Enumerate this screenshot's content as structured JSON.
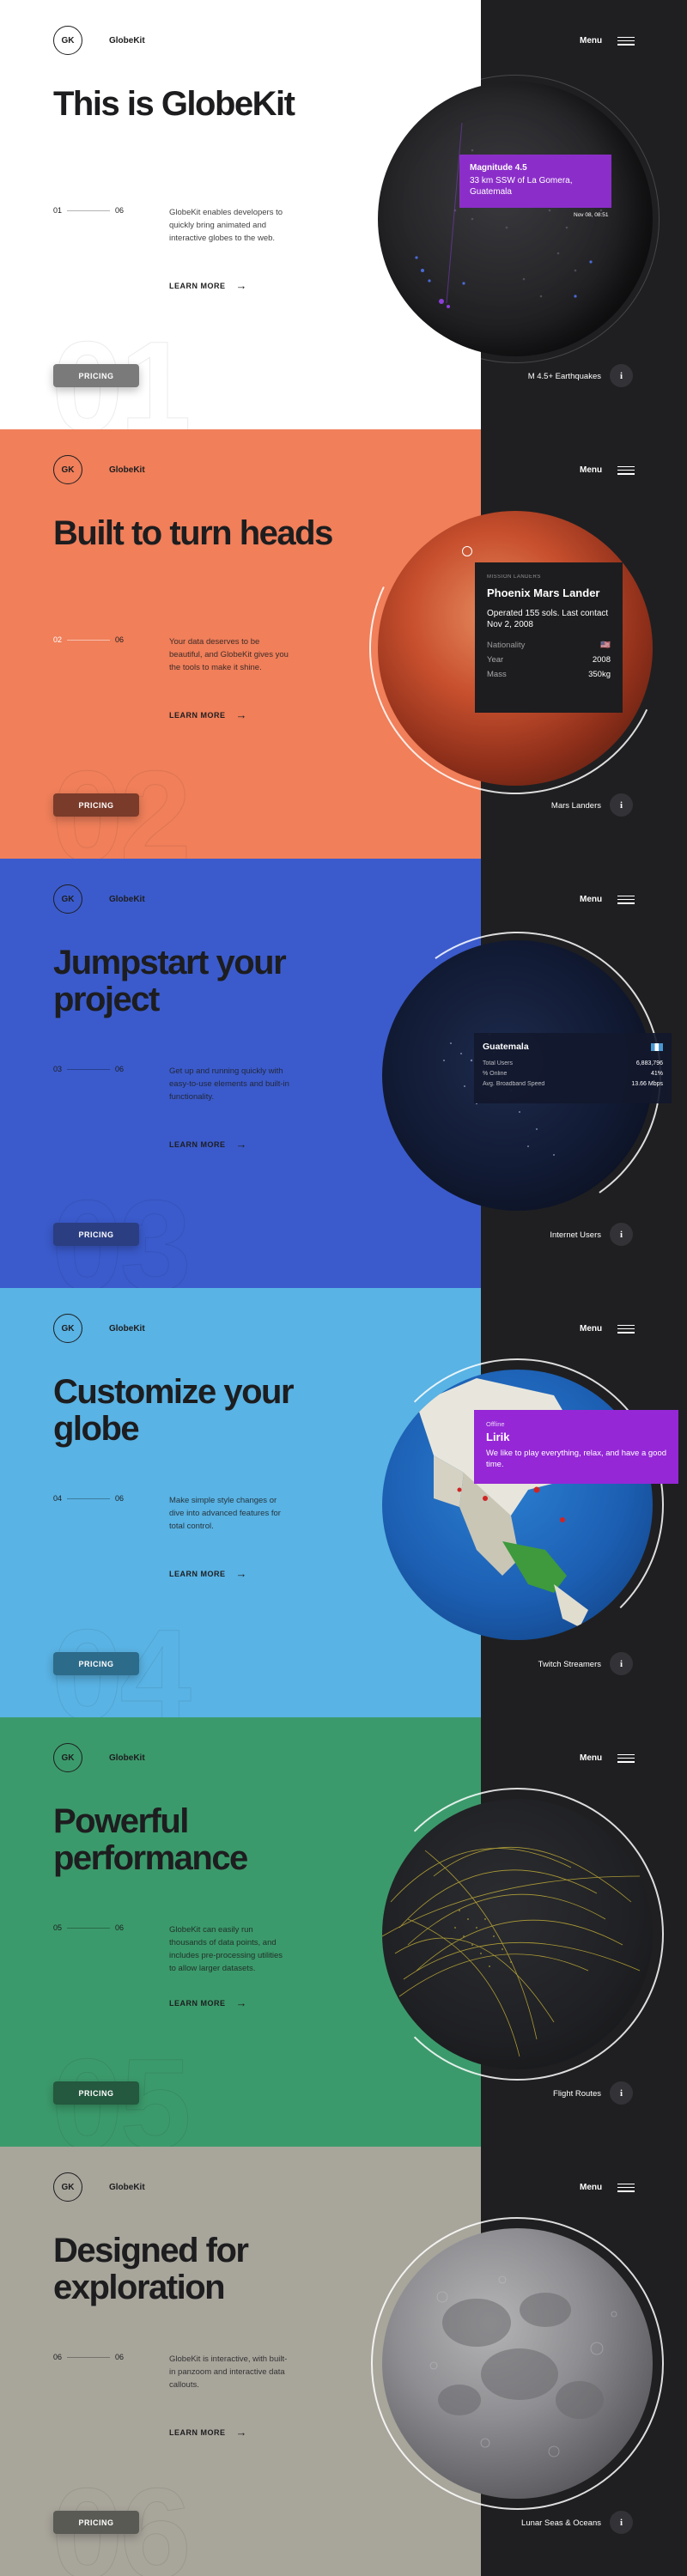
{
  "brand": {
    "logo": "GK",
    "name": "GlobeKit"
  },
  "nav": {
    "menu_label": "Menu"
  },
  "sections": [
    {
      "bg": "#ffffff",
      "accent": "#7a7a7a",
      "headline": "This is GlobeKit",
      "index": "01",
      "total": "06",
      "description": "GlobeKit enables developers to quickly bring animated and interactive globes to the web.",
      "learn_more": "LEARN MORE",
      "pricing": "PRICING",
      "big_number": "01",
      "globe_label": "M 4.5+ Earthquakes",
      "info": "i",
      "tooltip": {
        "title": "Magnitude 4.5",
        "body": "33 km SSW of La Gomera, Guatemala",
        "meta": "Nov 08, 08:51"
      }
    },
    {
      "bg": "#f07f5a",
      "accent": "#7a3b2a",
      "headline": "Built to turn heads",
      "index": "02",
      "total": "06",
      "description": "Your data deserves to be beautiful, and GlobeKit gives you the tools to make it shine.",
      "learn_more": "LEARN MORE",
      "pricing": "PRICING",
      "big_number": "02",
      "globe_label": "Mars Landers",
      "info": "i",
      "card": {
        "kicker": "MISSION LANDERS",
        "title": "Phoenix Mars Lander",
        "body": "Operated 155 sols. Last contact Nov 2, 2008",
        "rows": [
          {
            "label": "Nationality",
            "value": "🇺🇸"
          },
          {
            "label": "Year",
            "value": "2008"
          },
          {
            "label": "Mass",
            "value": "350kg"
          }
        ]
      }
    },
    {
      "bg": "#3b5bcc",
      "accent": "#2b3e82",
      "headline": "Jumpstart your project",
      "index": "03",
      "total": "06",
      "description": "Get up and running quickly with easy-to-use elements and built-in functionality.",
      "learn_more": "LEARN MORE",
      "pricing": "PRICING",
      "big_number": "03",
      "globe_label": "Internet Users",
      "info": "i",
      "card": {
        "title": "Guatemala",
        "rows": [
          {
            "label": "Total Users",
            "value": "6,883,796"
          },
          {
            "label": "% Online",
            "value": "41%"
          },
          {
            "label": "Avg. Broadband Speed",
            "value": "13.66 Mbps"
          }
        ]
      }
    },
    {
      "bg": "#59b3e4",
      "accent": "#2d6b8a",
      "headline": "Customize your globe",
      "index": "04",
      "total": "06",
      "description": "Make simple style changes or dive into advanced features for total control.",
      "learn_more": "LEARN MORE",
      "pricing": "PRICING",
      "big_number": "04",
      "globe_label": "Twitch Streamers",
      "info": "i",
      "tooltip": {
        "kicker": "Offline",
        "title": "Lirik",
        "body": "We like to play everything, relax, and have a good time."
      }
    },
    {
      "bg": "#3b9a6b",
      "accent": "#24583f",
      "headline": "Powerful performance",
      "index": "05",
      "total": "06",
      "description": "GlobeKit can easily run thousands of data points, and includes pre-processing utilities to allow larger datasets.",
      "learn_more": "LEARN MORE",
      "pricing": "PRICING",
      "big_number": "05",
      "globe_label": "Flight Routes",
      "info": "i"
    },
    {
      "bg": "#a8a59b",
      "accent": "#5a5a55",
      "headline": "Designed for exploration",
      "index": "06",
      "total": "06",
      "description": "GlobeKit is interactive, with built-in panzoom and interactive data callouts.",
      "learn_more": "LEARN MORE",
      "pricing": "PRICING",
      "big_number": "06",
      "globe_label": "Lunar Seas & Oceans",
      "info": "i"
    }
  ]
}
